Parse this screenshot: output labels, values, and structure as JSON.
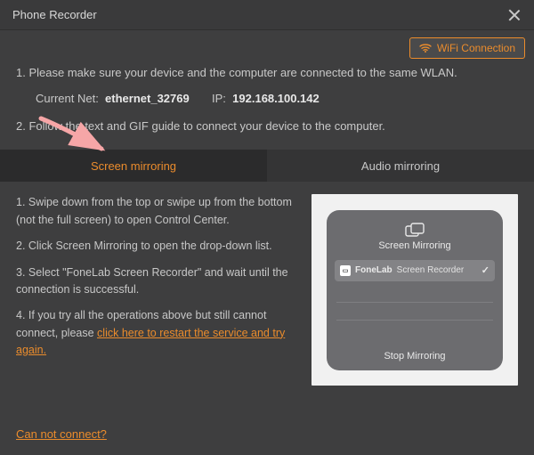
{
  "title": "Phone Recorder",
  "wifi_button": "WiFi Connection",
  "instructions": {
    "step1": "1. Please make sure your device and the computer are connected to the same WLAN.",
    "net_label": "Current Net:",
    "net_value": "ethernet_32769",
    "ip_label": "IP:",
    "ip_value": "192.168.100.142",
    "step2": "2. Follow the text and GIF guide to connect your device to the computer."
  },
  "tabs": {
    "screen": "Screen mirroring",
    "audio": "Audio mirroring"
  },
  "steps": {
    "s1": "1. Swipe down from the top or swipe up from the bottom (not the full screen) to open Control Center.",
    "s2": "2. Click Screen Mirroring to open the drop-down list.",
    "s3": "3. Select \"FoneLab Screen Recorder\" and wait until the connection is successful.",
    "s4_pre": "4. If you try all the operations above but still cannot connect, please ",
    "s4_link": "click here to restart the service and try again."
  },
  "preview": {
    "title": "Screen Mirroring",
    "brand": "FoneLab",
    "device": "Screen Recorder",
    "stop": "Stop Mirroring"
  },
  "footer_link": "Can not connect?"
}
